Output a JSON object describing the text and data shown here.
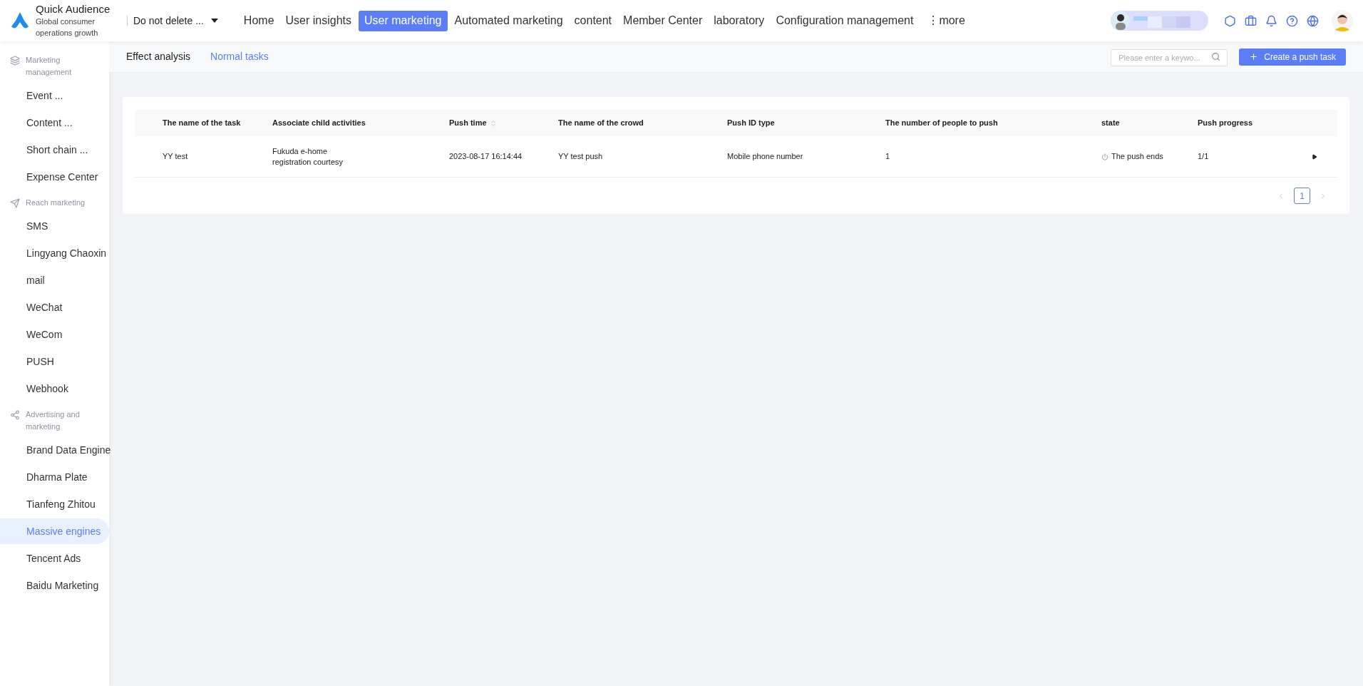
{
  "brand": {
    "title": "Quick Audience",
    "subtitle": "Global consumer operations growth"
  },
  "workspace": {
    "label": "Do not delete ..."
  },
  "nav": [
    {
      "label": "Home",
      "selected": false
    },
    {
      "label": "User insights",
      "selected": false
    },
    {
      "label": "User marketing",
      "selected": true
    },
    {
      "label": "Automated marketing",
      "selected": false
    },
    {
      "label": "content",
      "selected": false
    },
    {
      "label": "Member Center",
      "selected": false
    },
    {
      "label": "laboratory",
      "selected": false
    },
    {
      "label": "Configuration management",
      "selected": false
    }
  ],
  "more": {
    "icon": "⋮",
    "label": "more"
  },
  "sidebar": {
    "groups": [
      {
        "kind": "layers",
        "label": "Marketing management",
        "items": [
          {
            "label": "Event ...",
            "selected": false
          },
          {
            "label": "Content ...",
            "selected": false
          },
          {
            "label": "Short chain ...",
            "selected": false
          },
          {
            "label": "Expense Center",
            "selected": false
          }
        ]
      },
      {
        "kind": "send",
        "label": "Reach marketing",
        "items": [
          {
            "label": "SMS",
            "selected": false
          },
          {
            "label": "Lingyang Chaoxin",
            "selected": false
          },
          {
            "label": "mail",
            "selected": false
          },
          {
            "label": "WeChat",
            "selected": false
          },
          {
            "label": "WeCom",
            "selected": false
          },
          {
            "label": "PUSH",
            "selected": false
          },
          {
            "label": "Webhook",
            "selected": false
          }
        ]
      },
      {
        "kind": "network",
        "label": "Advertising and marketing",
        "items": [
          {
            "label": "Brand Data Engine",
            "selected": false
          },
          {
            "label": "Dharma Plate",
            "selected": false
          },
          {
            "label": "Tianfeng Zhitou",
            "selected": false
          },
          {
            "label": "Massive engines",
            "selected": true
          },
          {
            "label": "Tencent Ads",
            "selected": false
          },
          {
            "label": "Baidu Marketing",
            "selected": false
          }
        ]
      }
    ]
  },
  "tabs": [
    {
      "label": "Effect analysis",
      "selected": false
    },
    {
      "label": "Normal tasks",
      "selected": true
    }
  ],
  "search": {
    "placeholder": "Please enter a keywo..."
  },
  "create_button": {
    "label": "Create a push task"
  },
  "table": {
    "columns": [
      {
        "label": "The name of the task",
        "sortable": false
      },
      {
        "label": "Associate child activities",
        "sortable": false
      },
      {
        "label": "Push time",
        "sortable": true
      },
      {
        "label": "The name of the crowd",
        "sortable": false
      },
      {
        "label": "Push ID type",
        "sortable": false
      },
      {
        "label": "The number of people to push",
        "sortable": false
      },
      {
        "label": "state",
        "sortable": false
      },
      {
        "label": "Push progress",
        "sortable": false
      }
    ],
    "rows": [
      {
        "cells": [
          "YY test",
          "Fukuda e-home\nregistration courtesy",
          "2023-08-17 16:14:44",
          "YY test push",
          "Mobile phone number",
          "1",
          "The push ends",
          "1/1"
        ]
      }
    ]
  },
  "pagination": {
    "pages": [
      {
        "label": "1",
        "selected": true
      }
    ]
  }
}
